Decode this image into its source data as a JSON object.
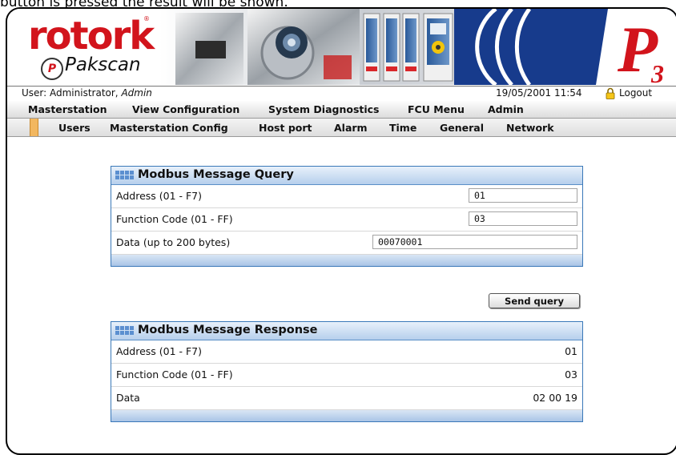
{
  "caption": "button is pressed the result will be shown.",
  "brand": {
    "logo_text": "rotork",
    "registered_mark": "®",
    "product_mark": "P",
    "product_name": "Pakscan"
  },
  "status": {
    "user_prefix": "User: Administrator, ",
    "user_name": "Admin",
    "datetime": "19/05/2001 11:54",
    "logout": "Logout"
  },
  "main_menu": [
    "Masterstation",
    "View Configuration",
    "System Diagnostics",
    "FCU Menu",
    "Admin"
  ],
  "sub_menu": [
    "Users",
    "Masterstation Config",
    "Host port",
    "Alarm",
    "Time",
    "General",
    "Network"
  ],
  "query_panel": {
    "title": "Modbus Message Query",
    "rows": [
      {
        "label": "Address (01 - F7)",
        "value": "01"
      },
      {
        "label": "Function Code (01 - FF)",
        "value": "03"
      },
      {
        "label": "Data (up to 200 bytes)",
        "value": "00070001"
      }
    ]
  },
  "send_button": "Send query",
  "response_panel": {
    "title": "Modbus Message Response",
    "rows": [
      {
        "label": "Address (01 - F7)",
        "value": "01"
      },
      {
        "label": "Function Code (01 - FF)",
        "value": "03"
      },
      {
        "label": "Data",
        "value": "02 00 19"
      }
    ]
  },
  "colors": {
    "brand_red": "#d2141c",
    "panel_blue": "#3a78b8",
    "submenu_accent": "#f2b760"
  }
}
